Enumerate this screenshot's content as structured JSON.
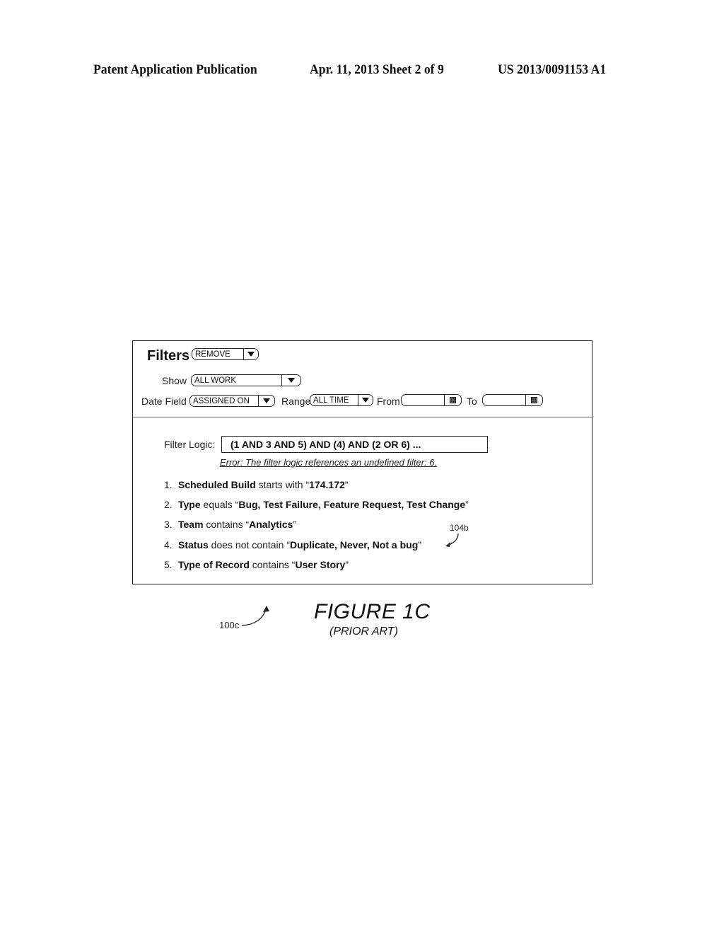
{
  "header": {
    "left": "Patent Application Publication",
    "center": "Apr. 11, 2013  Sheet 2 of 9",
    "right": "US 2013/0091153 A1"
  },
  "panel": {
    "title": "Filters",
    "title_dropdown": {
      "value": "REMOVE",
      "icon": "triangle-down-icon"
    },
    "show": {
      "label": "Show",
      "value": "ALL WORK",
      "icon": "triangle-down-icon"
    },
    "date_field": {
      "label": "Date Field",
      "value": "ASSIGNED ON",
      "icon": "triangle-down-icon"
    },
    "range": {
      "label": "Range",
      "value": "ALL TIME",
      "icon": "triangle-down-icon"
    },
    "from": {
      "label": "From",
      "value": "",
      "icon": "calendar-icon"
    },
    "to": {
      "label": "To",
      "value": "",
      "icon": "calendar-icon"
    },
    "filter_logic": {
      "label": "Filter Logic:",
      "value": "(1 AND 3 AND 5) AND (4) AND (2 OR 6) ...",
      "error": "Error: The filter logic references an undefined filter: 6."
    },
    "rules": [
      {
        "num": "1.",
        "field": "Scheduled Build",
        "op": " starts with “",
        "value": "174.172",
        "close": "”"
      },
      {
        "num": "2.",
        "field": "Type",
        "op": " equals “",
        "value": "Bug, Test Failure, Feature Request, Test Change",
        "close": "”"
      },
      {
        "num": "3.",
        "field": "Team",
        "op": " contains “",
        "value": "Analytics",
        "close": "”"
      },
      {
        "num": "4.",
        "field": "Status",
        "op": " does not contain “",
        "value": "Duplicate, Never, Not a bug",
        "close": "”"
      },
      {
        "num": "5.",
        "field": "Type of Record",
        "op": " contains “",
        "value": "User Story",
        "close": "”"
      }
    ]
  },
  "annotations": {
    "ref_104b": "104b",
    "ref_100c": "100c"
  },
  "figure": {
    "title": "FIGURE 1C",
    "subtitle": "(PRIOR ART)"
  }
}
